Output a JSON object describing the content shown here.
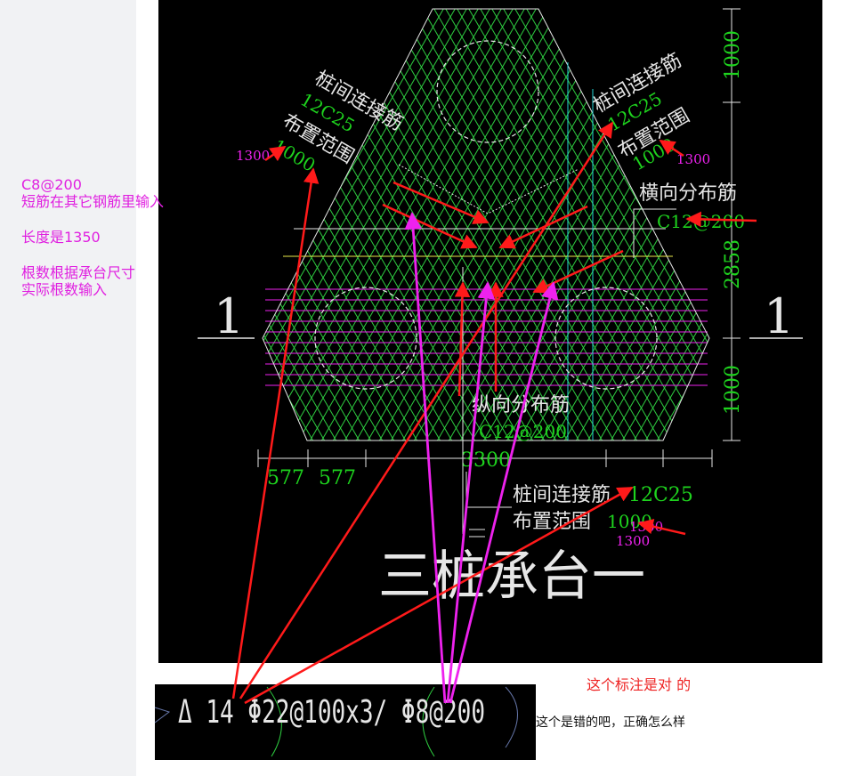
{
  "colors": {
    "cad_background": "#000000",
    "rebar_green": "#2ecc40",
    "dimension_green": "#1ed31e",
    "annotation_magenta": "#ee22ee",
    "arrow_red": "#ff1a1a",
    "outline_white": "#e6e6e6",
    "cyan_line": "#22d3d3",
    "yellow_line": "#e8e84a"
  },
  "left_notes": {
    "line1": "C8@200",
    "line2": "短筋在其它钢筋里输入",
    "line3": "长度是1350",
    "line4": "根数根据承台尺寸",
    "line5": "实际根数输入"
  },
  "drawing": {
    "title": "三桩承台一",
    "section_mark_left": "1",
    "section_mark_right": "1",
    "labels": {
      "tl_connect": "桩间连接筋",
      "tl_spec": "12C25",
      "tl_range": "布置范围",
      "tl_range_value": "1000",
      "tl_magenta": "1300",
      "tr_connect": "桩间连接筋",
      "tr_spec": "12C25",
      "tr_range": "布置范围",
      "tr_range_value": "1000",
      "tr_magenta": "1300",
      "horizontal": "横向分布筋",
      "horizontal_spec": "C12@200",
      "vertical": "纵向分布筋",
      "vertical_spec": "C12@200",
      "bottom_connect": "桩间连接筋",
      "bottom_spec": "12C25",
      "bottom_range": "布置范围",
      "bottom_range_value": "1000",
      "bottom_magenta_a": "1300",
      "bottom_magenta_b": "1300"
    },
    "dimensions": {
      "right_top": "1000",
      "right_mid": "2858",
      "right_bottom": "1000",
      "bottom_left_a": "577",
      "bottom_left_b": "577",
      "bottom_total": "3300"
    }
  },
  "formula_strip": {
    "text": "Δ 14 Φ22@100x3/ Φ8@200"
  },
  "right_comment": "这个标注是对  的",
  "bottom_comment": "这个是错的吧，正确怎么样"
}
